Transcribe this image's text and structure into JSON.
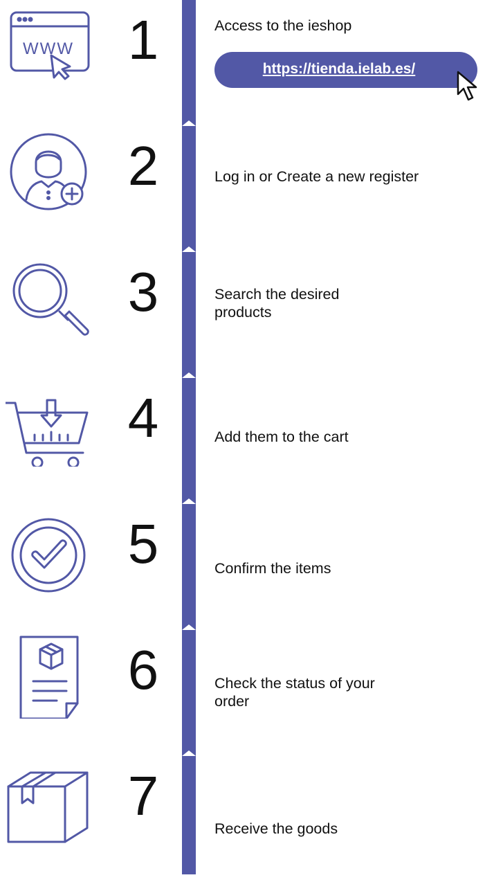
{
  "theme": {
    "accent": "#5258a6",
    "text": "#111111",
    "background": "#ffffff"
  },
  "steps": [
    {
      "number": "1",
      "icon": "browser-www-icon",
      "text": "Access to the ieshop",
      "link": "https://tienda.ielab.es/"
    },
    {
      "number": "2",
      "icon": "user-add-icon",
      "text": "Log in or Create a new register"
    },
    {
      "number": "3",
      "icon": "magnifier-icon",
      "text": "Search the desired\nproducts"
    },
    {
      "number": "4",
      "icon": "cart-download-icon",
      "text": "Add them to the cart"
    },
    {
      "number": "5",
      "icon": "check-circle-icon",
      "text": "Confirm the items"
    },
    {
      "number": "6",
      "icon": "order-document-icon",
      "text": "Check the status of your\norder"
    },
    {
      "number": "7",
      "icon": "package-box-icon",
      "text": "Receive the goods"
    }
  ]
}
